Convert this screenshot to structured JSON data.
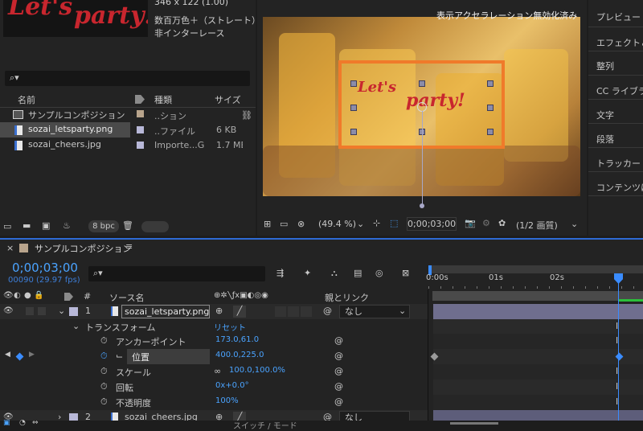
{
  "project": {
    "thumb_text": "Let's",
    "thumb_text2": "party!",
    "info_dims": "346 x 122 (1.00)",
    "info_color": "数百万色＋（ストレート）",
    "info_scan": "非インターレース",
    "search_placeholder": "",
    "columns": {
      "name": "名前",
      "type": "種類",
      "size": "サイズ"
    },
    "items": [
      {
        "name": "サンプルコンポジション",
        "type": "..ション",
        "size": "",
        "color": "#b8a48c",
        "icon": "composition-icon"
      },
      {
        "name": "sozai_letsparty.png",
        "type": "..ファイル",
        "size": "6 KB",
        "color": "#b8b8d8",
        "icon": "image-file-icon"
      },
      {
        "name": "sozai_cheers.jpg",
        "type": "Importe...G",
        "size": "1.7 MB",
        "color": "#b8b8d8",
        "icon": "image-file-icon"
      }
    ],
    "bpc": "8 bpc"
  },
  "viewer": {
    "overlay_text": "表示アクセラレーション無効化済み",
    "logo_text1": "Let's",
    "logo_text2": "party!",
    "zoom": "(49.4 %)",
    "timecode": "0;00;03;00",
    "resolution": "(1/2 画質)"
  },
  "right_panel": {
    "items": [
      "プレビュー",
      "エフェクト＆",
      "整列",
      "CC ライブラ",
      "文字",
      "段落",
      "トラッカー",
      "コンテンツに"
    ]
  },
  "timeline": {
    "comp_tab": "サンプルコンポジション",
    "timecode": "0;00;03;00",
    "frames": "00090 (29.97 fps)",
    "header": {
      "num": "#",
      "source": "ソース名",
      "parent": "親とリンク"
    },
    "layers": [
      {
        "num": "1",
        "name": "sozai_letsparty.png",
        "parent": "なし"
      },
      {
        "num": "2",
        "name": "sozai_cheers.jpg",
        "parent": "なし"
      }
    ],
    "transform": {
      "label": "トランスフォーム",
      "reset": "リセット"
    },
    "props": [
      {
        "name": "アンカーポイント",
        "value": "173.0,61.0"
      },
      {
        "name": "位置",
        "value": "400.0,225.0"
      },
      {
        "name": "スケール",
        "value": "100.0,100.0%"
      },
      {
        "name": "回転",
        "value": "0x+0.0°"
      },
      {
        "name": "不透明度",
        "value": "100%"
      }
    ],
    "ruler": [
      "0:00s",
      "01s",
      "02s"
    ],
    "footer": "スイッチ / モード"
  },
  "colors": {
    "accent": "#2e6bd4",
    "timecode": "#4aa3ff",
    "orange": "#f07a2a",
    "layer_bar": "#6f6e8e"
  }
}
